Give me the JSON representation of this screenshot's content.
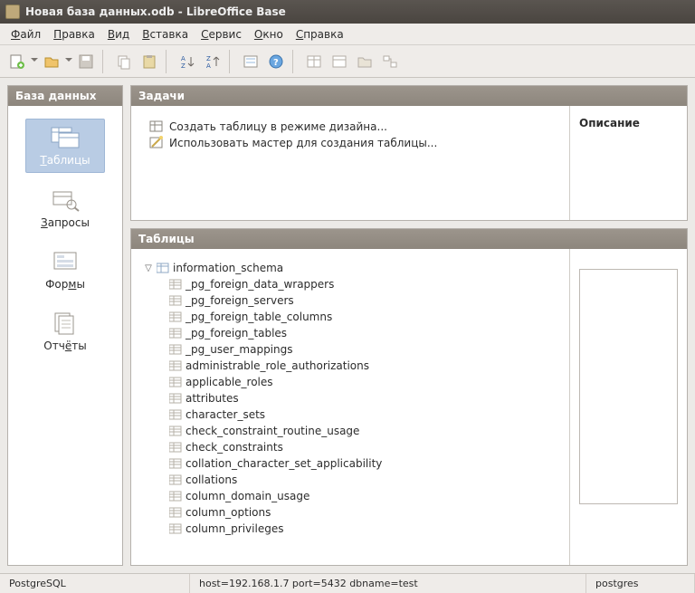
{
  "window": {
    "title": "Новая база данных.odb - LibreOffice Base"
  },
  "menu": {
    "file": {
      "label": "Файл",
      "u": "Ф"
    },
    "edit": {
      "label": "Правка",
      "u": "П"
    },
    "view": {
      "label": "Вид",
      "u": "В"
    },
    "insert": {
      "label": "Вставка",
      "u": "В"
    },
    "tools": {
      "label": "Сервис",
      "u": "С"
    },
    "window": {
      "label": "Окно",
      "u": "О"
    },
    "help": {
      "label": "Справка",
      "u": "С"
    }
  },
  "sidebar": {
    "header": "База данных",
    "items": [
      {
        "key": "tables",
        "label": "Таблицы",
        "underline": "Т",
        "selected": true
      },
      {
        "key": "queries",
        "label": "Запросы",
        "underline": "З",
        "selected": false
      },
      {
        "key": "forms",
        "label": "Формы",
        "underline": "м",
        "selected": false
      },
      {
        "key": "reports",
        "label": "Отчёты",
        "underline": "ё",
        "selected": false
      }
    ]
  },
  "tasks": {
    "header": "Задачи",
    "items": [
      "Создать таблицу в режиме дизайна...",
      "Использовать мастер для создания таблицы..."
    ],
    "description_header": "Описание"
  },
  "tables": {
    "header": "Таблицы",
    "schema": "information_schema",
    "items": [
      "_pg_foreign_data_wrappers",
      "_pg_foreign_servers",
      "_pg_foreign_table_columns",
      "_pg_foreign_tables",
      "_pg_user_mappings",
      "administrable_role_authorizations",
      "applicable_roles",
      "attributes",
      "character_sets",
      "check_constraint_routine_usage",
      "check_constraints",
      "collation_character_set_applicability",
      "collations",
      "column_domain_usage",
      "column_options",
      "column_privileges"
    ]
  },
  "status": {
    "driver": "PostgreSQL",
    "conn": "host=192.168.1.7 port=5432 dbname=test",
    "user": "postgres"
  }
}
